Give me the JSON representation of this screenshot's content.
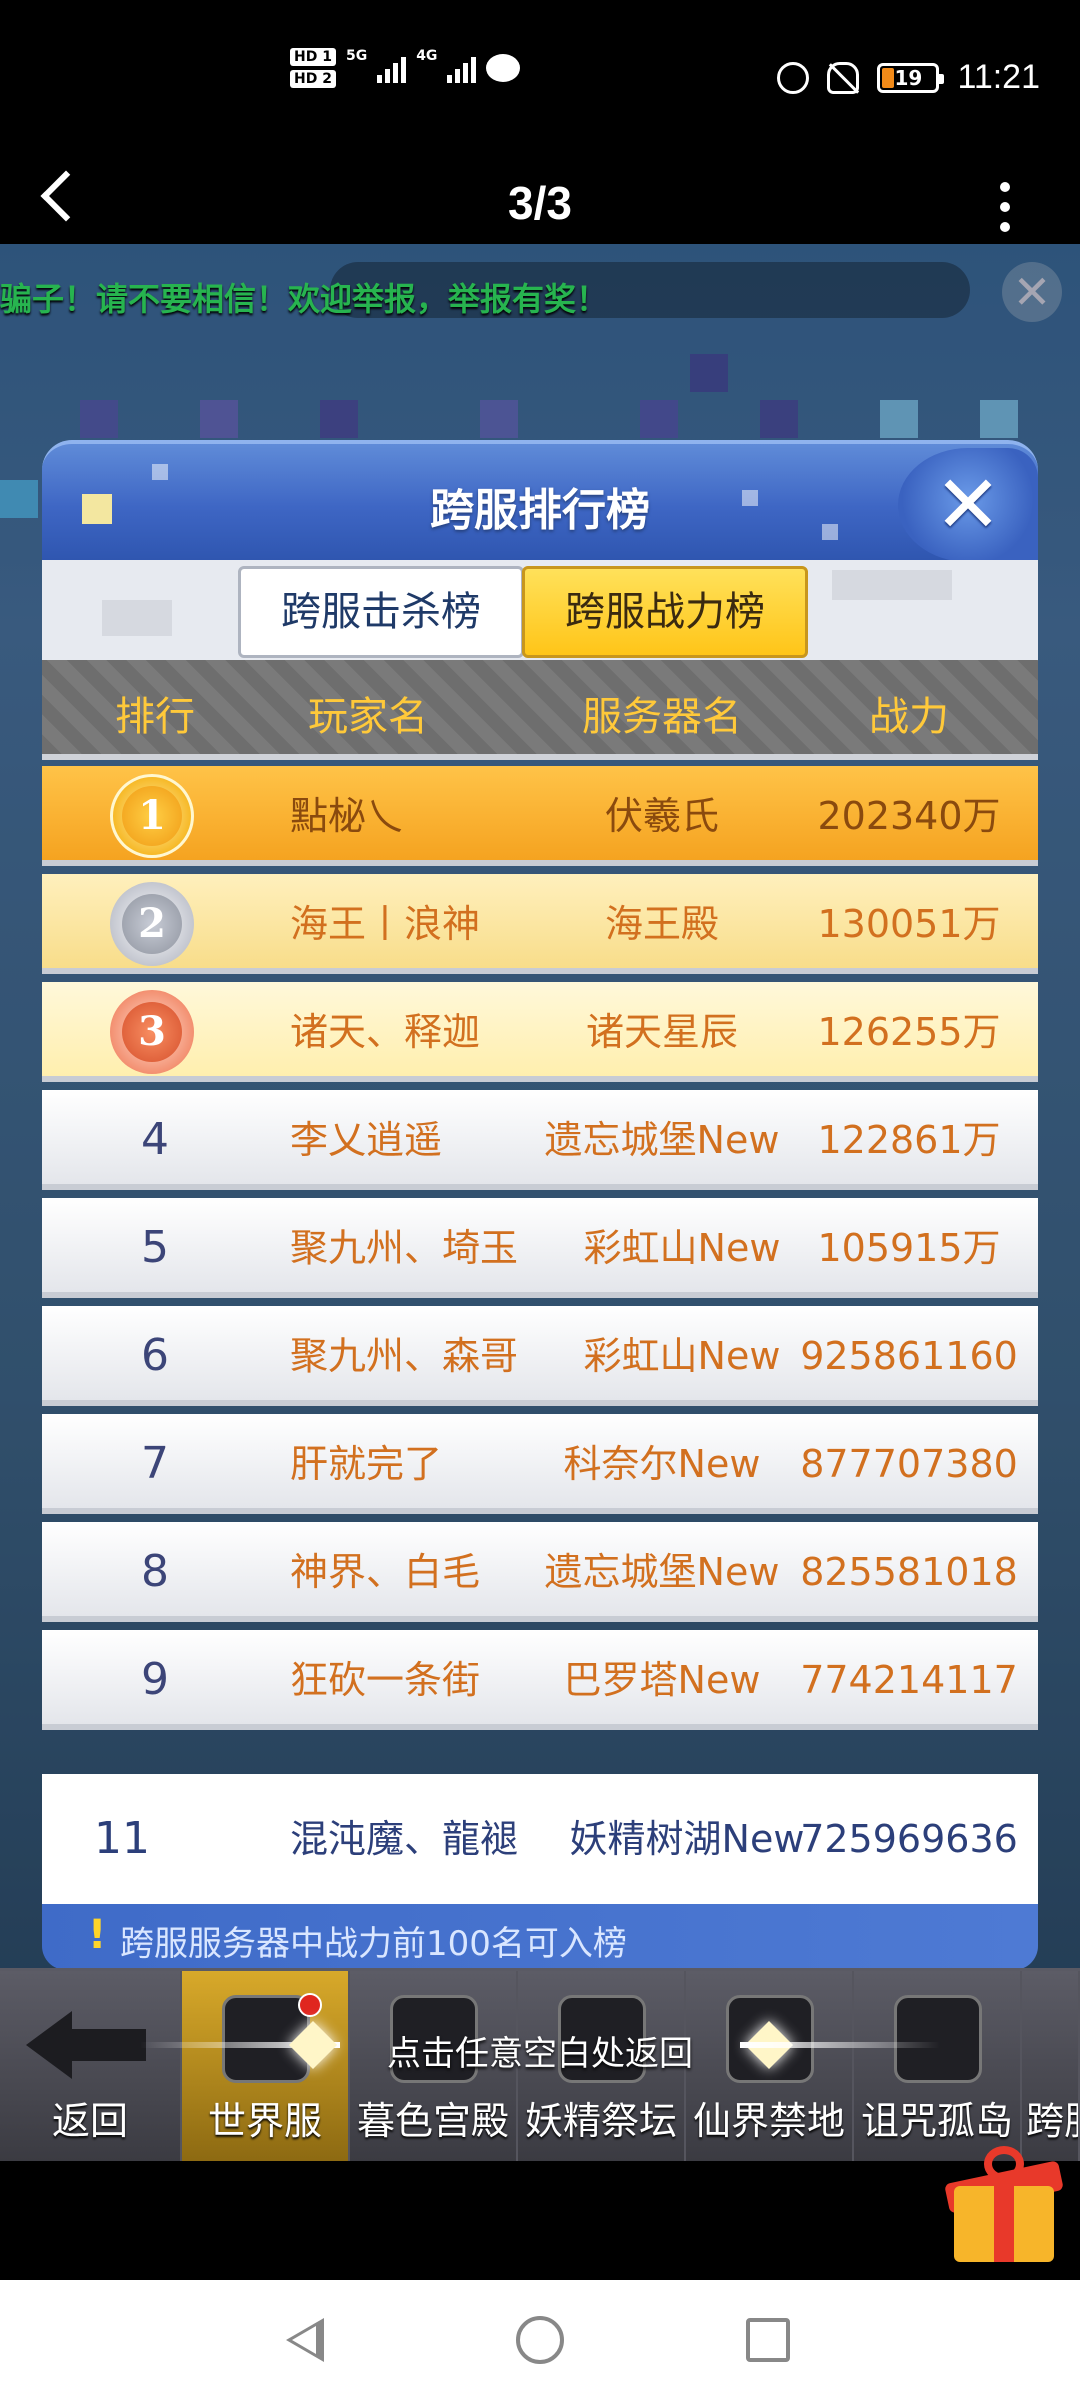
{
  "status_bar": {
    "sim1": "HD 1",
    "sim2": "HD 2",
    "net1": "5G",
    "net2": "4G",
    "battery": "19",
    "time": "11:21"
  },
  "viewer": {
    "page_indicator": "3/3"
  },
  "game": {
    "ticker": "骗子！请不要相信！欢迎举报，举报有奖！",
    "close_symbol": "✕"
  },
  "panel": {
    "title": "跨服排行榜",
    "close_symbol": "✕",
    "tabs": [
      {
        "label": "跨服击杀榜",
        "active": false
      },
      {
        "label": "跨服战力榜",
        "active": true
      }
    ],
    "columns": [
      "排行",
      "玩家名",
      "服务器名",
      "战力"
    ],
    "rows": [
      {
        "rank": "1",
        "name": "點柲乀",
        "server": "伏羲氏",
        "power": "202340万"
      },
      {
        "rank": "2",
        "name": "海王丨浪神",
        "server": "海王殿",
        "power": "130051万"
      },
      {
        "rank": "3",
        "name": "诸天、释迦",
        "server": "诸天星辰",
        "power": "126255万"
      },
      {
        "rank": "4",
        "name": "李乂逍遥",
        "server": "遗忘城堡New",
        "power": "122861万"
      },
      {
        "rank": "5",
        "name": "聚九州、埼玉",
        "server": "彩虹山New",
        "power": "105915万"
      },
      {
        "rank": "6",
        "name": "聚九州、森哥",
        "server": "彩虹山New",
        "power": "925861160"
      },
      {
        "rank": "7",
        "name": "肝就完了",
        "server": "科奈尔New",
        "power": "877707380"
      },
      {
        "rank": "8",
        "name": "神界、白毛",
        "server": "遗忘城堡New",
        "power": "825581018"
      },
      {
        "rank": "9",
        "name": "狂砍一条街",
        "server": "巴罗塔New",
        "power": "774214117"
      }
    ],
    "self_row": {
      "rank": "11",
      "name": "混沌魔、龍褪",
      "server": "妖精树湖New",
      "power": "725969636"
    },
    "footer_note": "跨服服务器中战力前100名可入榜",
    "footer_mark": "!"
  },
  "bottom_nav": {
    "hint": "点击任意空白处返回",
    "items": [
      "返回",
      "世界服",
      "暮色宫殿",
      "妖精祭坛",
      "仙界禁地",
      "诅咒孤岛",
      "跨服"
    ]
  },
  "colors": {
    "gold_row": "#f5a320",
    "header_text": "#ffc93a",
    "name_text": "#d2701f",
    "panel_blue": "#3e66c4",
    "ticker_green": "#34f06a"
  }
}
